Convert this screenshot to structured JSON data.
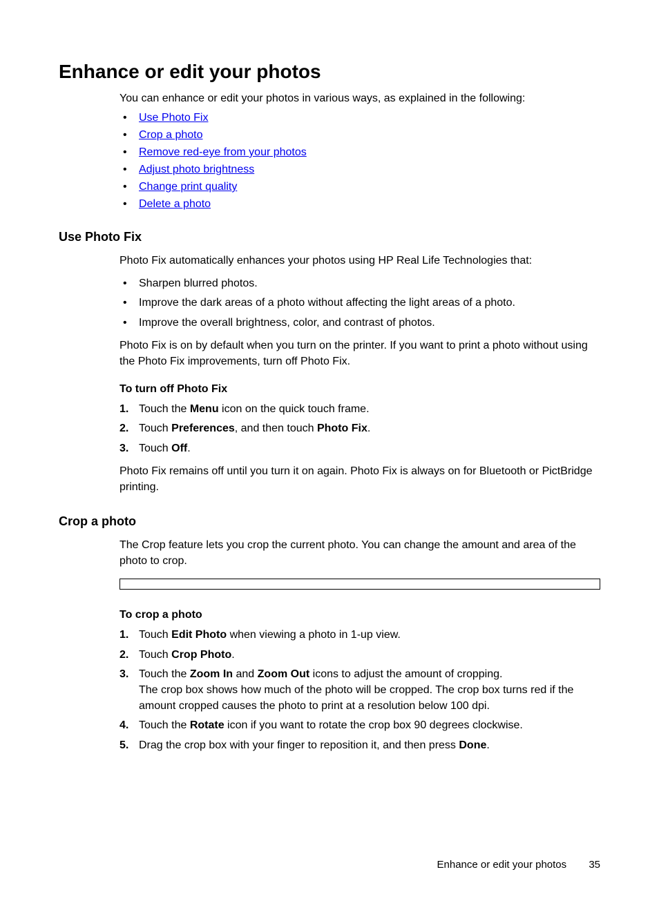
{
  "title": "Enhance or edit your photos",
  "intro": "You can enhance or edit your photos in various ways, as explained in the following:",
  "links": [
    "Use Photo Fix",
    "Crop a photo",
    "Remove red-eye from your photos",
    "Adjust photo brightness",
    "Change print quality",
    "Delete a photo"
  ],
  "section1": {
    "heading": "Use Photo Fix",
    "intro": "Photo Fix automatically enhances your photos using HP Real Life Technologies that:",
    "bullets": [
      "Sharpen blurred photos.",
      "Improve the dark areas of a photo without affecting the light areas of a photo.",
      "Improve the overall brightness, color, and contrast of photos."
    ],
    "para1": "Photo Fix is on by default when you turn on the printer. If you want to print a photo without using the Photo Fix improvements, turn off Photo Fix.",
    "subheading": "To turn off Photo Fix",
    "step1_a": "Touch the ",
    "step1_b": "Menu",
    "step1_c": " icon on the quick touch frame.",
    "step2_a": "Touch ",
    "step2_b": "Preferences",
    "step2_c": ", and then touch ",
    "step2_d": "Photo Fix",
    "step2_e": ".",
    "step3_a": "Touch ",
    "step3_b": "Off",
    "step3_c": ".",
    "para2": "Photo Fix remains off until you turn it on again. Photo Fix is always on for Bluetooth or PictBridge printing."
  },
  "section2": {
    "heading": "Crop a photo",
    "intro": "The Crop feature lets you crop the current photo. You can change the amount and area of the photo to crop.",
    "subheading": "To crop a photo",
    "step1_a": "Touch ",
    "step1_b": "Edit Photo",
    "step1_c": " when viewing a photo in 1-up view.",
    "step2_a": "Touch ",
    "step2_b": "Crop Photo",
    "step2_c": ".",
    "step3_a": "Touch the ",
    "step3_b": "Zoom In",
    "step3_c": " and ",
    "step3_d": "Zoom Out",
    "step3_e": " icons to adjust the amount of cropping.",
    "step3_f": "The crop box shows how much of the photo will be cropped. The crop box turns red if the amount cropped causes the photo to print at a resolution below 100 dpi.",
    "step4_a": "Touch the ",
    "step4_b": "Rotate",
    "step4_c": " icon if you want to rotate the crop box 90 degrees clockwise.",
    "step5_a": "Drag the crop box with your finger to reposition it, and then press ",
    "step5_b": "Done",
    "step5_c": "."
  },
  "footer": {
    "text": "Enhance or edit your photos",
    "page": "35"
  }
}
